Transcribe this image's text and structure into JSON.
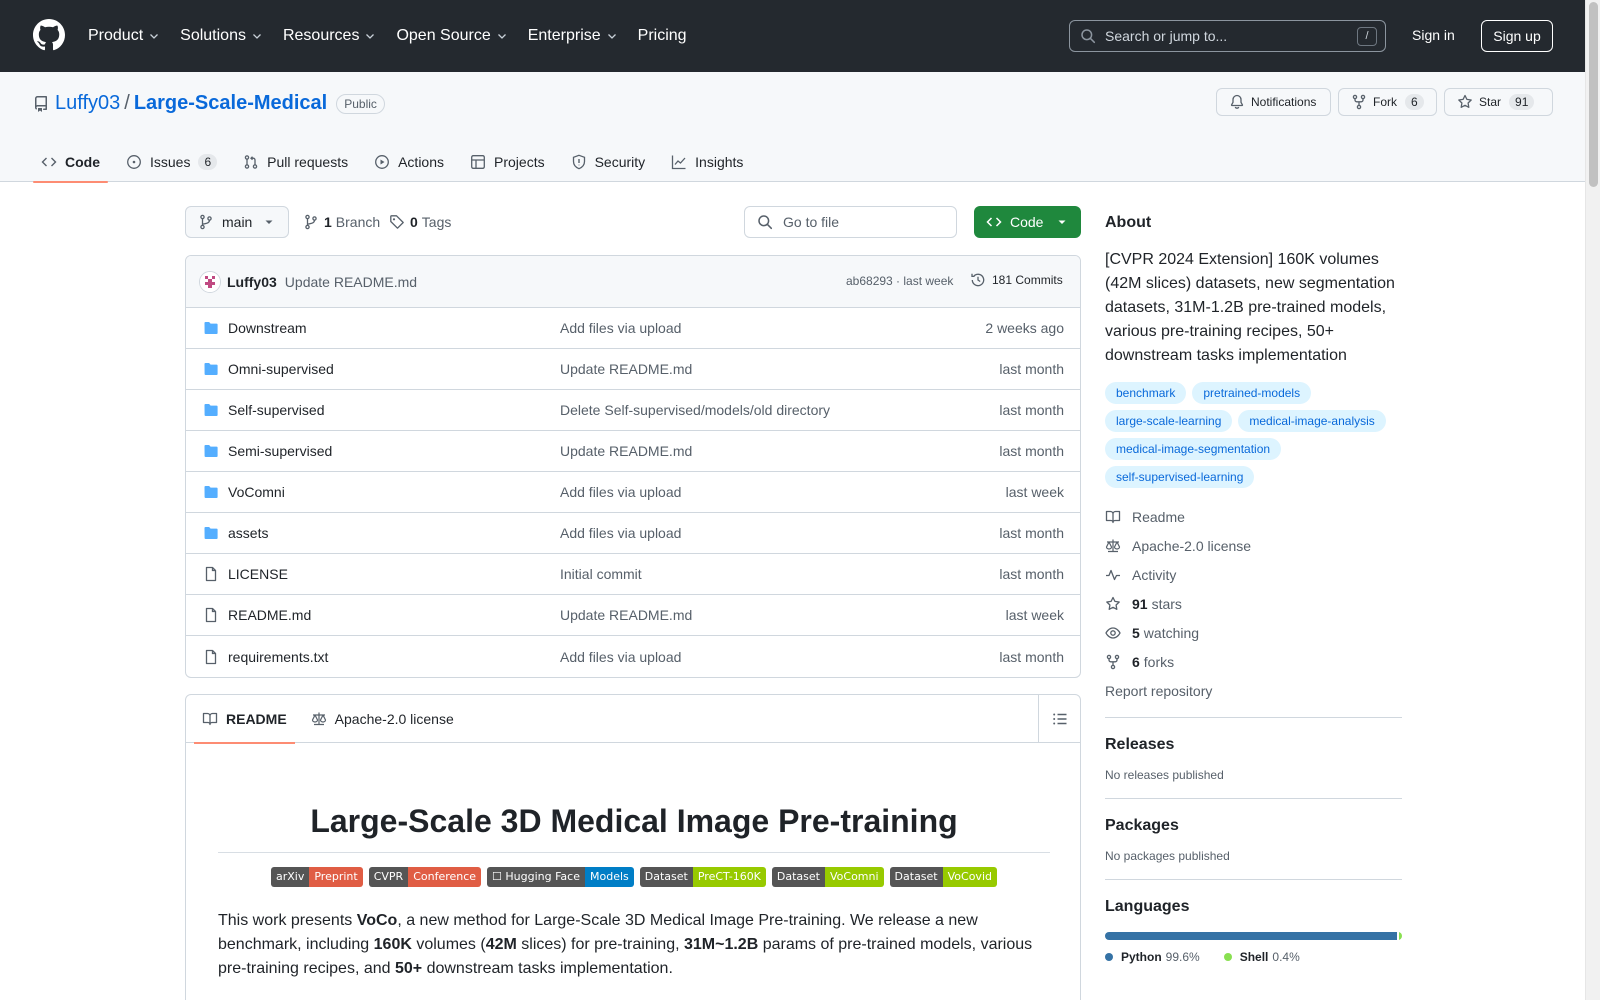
{
  "header": {
    "nav": [
      "Product",
      "Solutions",
      "Resources",
      "Open Source",
      "Enterprise",
      "Pricing"
    ],
    "search_placeholder": "Search or jump to...",
    "search_shortcut": "/",
    "sign_in": "Sign in",
    "sign_up": "Sign up"
  },
  "repo": {
    "owner": "Luffy03",
    "separator": "/",
    "name": "Large-Scale-Medical",
    "visibility": "Public",
    "notifications_label": "Notifications",
    "fork_label": "Fork",
    "fork_count": "6",
    "star_label": "Star",
    "star_count": "91"
  },
  "tabs": [
    {
      "label": "Code",
      "icon": "code-icon",
      "active": true
    },
    {
      "label": "Issues",
      "icon": "issue-opened-icon",
      "count": "6"
    },
    {
      "label": "Pull requests",
      "icon": "git-pull-request-icon"
    },
    {
      "label": "Actions",
      "icon": "play-icon"
    },
    {
      "label": "Projects",
      "icon": "table-icon"
    },
    {
      "label": "Security",
      "icon": "shield-icon"
    },
    {
      "label": "Insights",
      "icon": "graph-icon"
    }
  ],
  "toolbar": {
    "branch": "main",
    "branch_count": "1",
    "branch_label": "Branch",
    "tag_count": "0",
    "tag_label": "Tags",
    "go_to_file": "Go to file",
    "code_button": "Code"
  },
  "latest_commit": {
    "author": "Luffy03",
    "message": "Update README.md",
    "meta": "ab68293 · last week",
    "commits": "181 Commits"
  },
  "files": [
    {
      "type": "dir",
      "name": "Downstream",
      "message": "Add files via upload",
      "date": "2 weeks ago"
    },
    {
      "type": "dir",
      "name": "Omni-supervised",
      "message": "Update README.md",
      "date": "last month"
    },
    {
      "type": "dir",
      "name": "Self-supervised",
      "message": "Delete Self-supervised/models/old directory",
      "date": "last month"
    },
    {
      "type": "dir",
      "name": "Semi-supervised",
      "message": "Update README.md",
      "date": "last month"
    },
    {
      "type": "dir",
      "name": "VoComni",
      "message": "Add files via upload",
      "date": "last week"
    },
    {
      "type": "dir",
      "name": "assets",
      "message": "Add files via upload",
      "date": "last month"
    },
    {
      "type": "file",
      "name": "LICENSE",
      "message": "Initial commit",
      "date": "last month"
    },
    {
      "type": "file",
      "name": "README.md",
      "message": "Update README.md",
      "date": "last week"
    },
    {
      "type": "file",
      "name": "requirements.txt",
      "message": "Add files via upload",
      "date": "last month"
    }
  ],
  "readme": {
    "tab_readme": "README",
    "tab_license": "Apache-2.0 license",
    "title": "Large-Scale 3D Medical Image Pre-training",
    "badges": [
      {
        "left": "arXiv",
        "right": "Preprint",
        "color": "#e05d44"
      },
      {
        "left": "CVPR",
        "right": "Conference",
        "color": "#e05d44"
      },
      {
        "left": "☐ Hugging Face",
        "right": "Models",
        "color": "#007ec6"
      },
      {
        "left": "Dataset",
        "right": "PreCT-160K",
        "color": "#97ca00"
      },
      {
        "left": "Dataset",
        "right": "VoComni",
        "color": "#97ca00"
      },
      {
        "left": "Dataset",
        "right": "VoCovid",
        "color": "#97ca00"
      }
    ],
    "paragraph": [
      {
        "t": "This work presents "
      },
      {
        "t": "VoCo",
        "b": true
      },
      {
        "t": ", a new method for Large-Scale 3D Medical Image Pre-training. We release a new benchmark, including "
      },
      {
        "t": "160K",
        "b": true
      },
      {
        "t": " volumes ("
      },
      {
        "t": "42M",
        "b": true
      },
      {
        "t": " slices) for pre-training, "
      },
      {
        "t": "31M~1.2B",
        "b": true
      },
      {
        "t": " params of pre-trained models, various pre-training recipes, and "
      },
      {
        "t": "50+",
        "b": true
      },
      {
        "t": " downstream tasks implementation."
      }
    ]
  },
  "about": {
    "heading": "About",
    "description": "[CVPR 2024 Extension] 160K volumes (42M slices) datasets, new segmentation datasets, 31M-1.2B pre-trained models, various pre-training recipes, 50+ downstream tasks implementation",
    "topics": [
      "benchmark",
      "pretrained-models",
      "large-scale-learning",
      "medical-image-analysis",
      "medical-image-segmentation",
      "self-supervised-learning"
    ],
    "links": [
      {
        "icon": "book-icon",
        "label": "Readme"
      },
      {
        "icon": "law-icon",
        "label": "Apache-2.0 license"
      },
      {
        "icon": "pulse-icon",
        "label": "Activity"
      },
      {
        "icon": "star-icon",
        "count": "91",
        "label": "stars"
      },
      {
        "icon": "eye-icon",
        "count": "5",
        "label": "watching"
      },
      {
        "icon": "repo-forked-icon",
        "count": "6",
        "label": "forks"
      }
    ],
    "report": "Report repository"
  },
  "releases": {
    "heading": "Releases",
    "text": "No releases published"
  },
  "packages": {
    "heading": "Packages",
    "text": "No packages published"
  },
  "languages": {
    "heading": "Languages",
    "items": [
      {
        "name": "Python",
        "percent": "99.6%",
        "fraction": 0.996,
        "color": "#3572A5"
      },
      {
        "name": "Shell",
        "percent": "0.4%",
        "fraction": 0.004,
        "color": "#89e051"
      }
    ]
  }
}
